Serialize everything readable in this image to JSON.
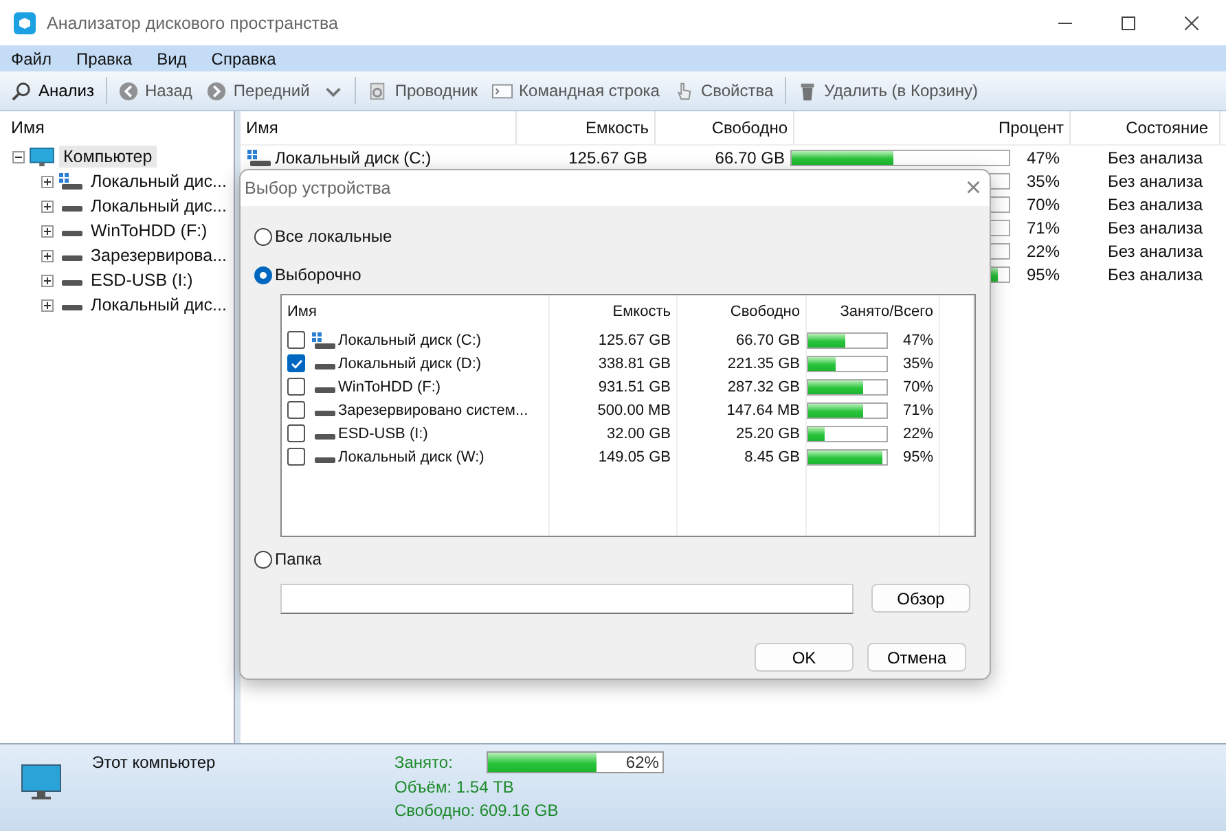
{
  "window": {
    "title": "Анализатор дискового пространства"
  },
  "menu": [
    "Файл",
    "Правка",
    "Вид",
    "Справка"
  ],
  "toolbar": [
    {
      "label": "Анализ",
      "kind": "search",
      "disabled": false
    },
    {
      "label": "Назад",
      "kind": "back",
      "disabled": true
    },
    {
      "label": "Передний",
      "kind": "forward",
      "disabled": true
    },
    {
      "kind": "dropdown",
      "disabled": true
    },
    {
      "label": "Проводник",
      "kind": "explorer",
      "disabled": true
    },
    {
      "label": "Командная строка",
      "kind": "console",
      "disabled": true
    },
    {
      "label": "Свойства",
      "kind": "properties",
      "disabled": true
    },
    {
      "label": "Удалить (в Корзину)",
      "kind": "trash",
      "disabled": true
    }
  ],
  "tree": {
    "header": "Имя",
    "items": [
      {
        "label": "Компьютер",
        "kind": "computer",
        "expanded": true,
        "selected": true,
        "children": [
          {
            "label": "Локальный дис...",
            "kind": "system",
            "expanded": false,
            "selected": false
          },
          {
            "label": "Локальный дис...",
            "kind": "drive",
            "expanded": false,
            "selected": false
          },
          {
            "label": "WinToHDD (F:)",
            "kind": "drive",
            "expanded": false,
            "selected": false
          },
          {
            "label": "Зарезервирова...",
            "kind": "drive",
            "expanded": false,
            "selected": false
          },
          {
            "label": "ESD-USB (I:)",
            "kind": "drive",
            "expanded": false,
            "selected": false
          },
          {
            "label": "Локальный дис...",
            "kind": "drive",
            "expanded": false,
            "selected": false
          }
        ]
      }
    ]
  },
  "table": {
    "columns": [
      "Имя",
      "Емкость",
      "Свободно",
      "Процент",
      "Состояние"
    ],
    "rows": [
      {
        "name": "Локальный диск (C:)",
        "kind": "system",
        "capacity": "125.67 GB",
        "free": "66.70 GB",
        "level": 0.47,
        "percent": "47%",
        "status": "Без анализа"
      },
      {
        "percent": "35%",
        "status": "Без анализа"
      },
      {
        "percent": "70%",
        "status": "Без анализа"
      },
      {
        "percent": "71%",
        "status": "Без анализа"
      },
      {
        "percent": "22%",
        "status": "Без анализа"
      },
      {
        "level": 0.95,
        "percent": "95%",
        "status": "Без анализа"
      }
    ]
  },
  "dialog": {
    "title": "Выбор устройства",
    "close": "×",
    "options": [
      {
        "label": "Все локальные",
        "selected": false
      },
      {
        "label": "Выборочно",
        "selected": true
      }
    ],
    "list": {
      "columns": [
        "Имя",
        "Емкость",
        "Свободно",
        "Занято/Всего"
      ],
      "rows": [
        {
          "name": "Локальный диск (C:)",
          "kind": "system",
          "checked": false,
          "capacity": "125.67 GB",
          "free": "66.70 GB",
          "level": 0.47,
          "percent": "47%"
        },
        {
          "name": "Локальный диск (D:)",
          "kind": "drive",
          "checked": true,
          "capacity": "338.81 GB",
          "free": "221.35 GB",
          "level": 0.35,
          "percent": "35%"
        },
        {
          "name": "WinToHDD (F:)",
          "kind": "drive",
          "checked": false,
          "capacity": "931.51 GB",
          "free": "287.32 GB",
          "level": 0.7,
          "percent": "70%"
        },
        {
          "name": "Зарезервировано систем...",
          "kind": "drive",
          "checked": false,
          "capacity": "500.00 MB",
          "free": "147.64 MB",
          "level": 0.71,
          "percent": "71%"
        },
        {
          "name": "ESD-USB (I:)",
          "kind": "drive",
          "checked": false,
          "capacity": "32.00 GB",
          "free": "25.20 GB",
          "level": 0.22,
          "percent": "22%"
        },
        {
          "name": "Локальный диск (W:)",
          "kind": "drive",
          "checked": false,
          "capacity": "149.05 GB",
          "free": "8.45 GB",
          "level": 0.95,
          "percent": "95%"
        }
      ]
    },
    "folder": {
      "label": "Папка",
      "selected": false
    },
    "browse": "Обзор",
    "buttons": [
      "OK",
      "Отмена"
    ]
  },
  "status": {
    "name": "Этот компьютер",
    "used_label": "Занято:",
    "level": 0.62,
    "percent": "62%",
    "volume": "Объём: 1.54 TB",
    "free": "Свободно: 609.16 GB"
  }
}
